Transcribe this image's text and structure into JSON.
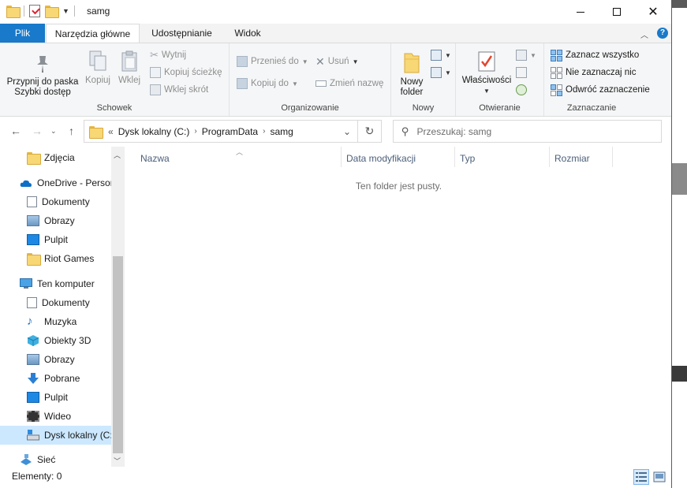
{
  "window": {
    "title": "samg"
  },
  "ribbon_tabs": [
    {
      "label": "Plik"
    },
    {
      "label": "Narzędzia główne"
    },
    {
      "label": "Udostępnianie"
    },
    {
      "label": "Widok"
    }
  ],
  "help": {
    "label": "?"
  },
  "ribbon": {
    "schowek": {
      "label": "Schowek",
      "pin": "Przypnij do paska\nSzybki dostęp",
      "pin_line1": "Przypnij do paska",
      "pin_line2": "Szybki dostęp",
      "copy": "Kopiuj",
      "paste": "Wklej",
      "cut": "Wytnij",
      "copy_path": "Kopiuj ścieżkę",
      "paste_shortcut": "Wklej skrót"
    },
    "organizuj": {
      "label": "Organizowanie",
      "move_to": "Przenieś do",
      "copy_to": "Kopiuj do",
      "delete": "Usuń",
      "rename": "Zmień nazwę"
    },
    "nowy": {
      "label": "Nowy",
      "new_folder_l1": "Nowy",
      "new_folder_l2": "folder"
    },
    "otwieranie": {
      "label": "Otwieranie",
      "properties": "Właściwości"
    },
    "zaznaczanie": {
      "label": "Zaznaczanie",
      "select_all": "Zaznacz wszystko",
      "select_none": "Nie zaznaczaj nic",
      "invert": "Odwróć zaznaczenie"
    }
  },
  "address": {
    "prefix": "«",
    "crumbs": [
      "Dysk lokalny (C:)",
      "ProgramData",
      "samg"
    ]
  },
  "search": {
    "placeholder": "Przeszukaj: samg"
  },
  "nav": [
    {
      "label": "Zdjęcia",
      "icon": "folder-icon"
    },
    {
      "label": "OneDrive - Persor",
      "icon": "cloud-icon"
    },
    {
      "label": "Dokumenty",
      "icon": "documents-icon"
    },
    {
      "label": "Obrazy",
      "icon": "pictures-icon"
    },
    {
      "label": "Pulpit",
      "icon": "desktop-icon"
    },
    {
      "label": "Riot Games",
      "icon": "folder-icon"
    },
    {
      "label": "Ten komputer",
      "icon": "computer-icon"
    },
    {
      "label": "Dokumenty",
      "icon": "documents-icon"
    },
    {
      "label": "Muzyka",
      "icon": "music-icon"
    },
    {
      "label": "Obiekty 3D",
      "icon": "3d-objects-icon"
    },
    {
      "label": "Obrazy",
      "icon": "pictures-icon"
    },
    {
      "label": "Pobrane",
      "icon": "downloads-icon"
    },
    {
      "label": "Pulpit",
      "icon": "desktop-icon"
    },
    {
      "label": "Wideo",
      "icon": "video-icon"
    },
    {
      "label": "Dysk lokalny (C:)",
      "icon": "drive-icon"
    },
    {
      "label": "Sieć",
      "icon": "network-icon"
    }
  ],
  "columns": [
    "Nazwa",
    "Data modyfikacji",
    "Typ",
    "Rozmiar"
  ],
  "empty_message": "Ten folder jest pusty.",
  "status": {
    "items": "Elementy: 0"
  },
  "colors": {
    "accent": "#1979ca",
    "selection": "#cce8ff",
    "folder": "#f8d775"
  }
}
